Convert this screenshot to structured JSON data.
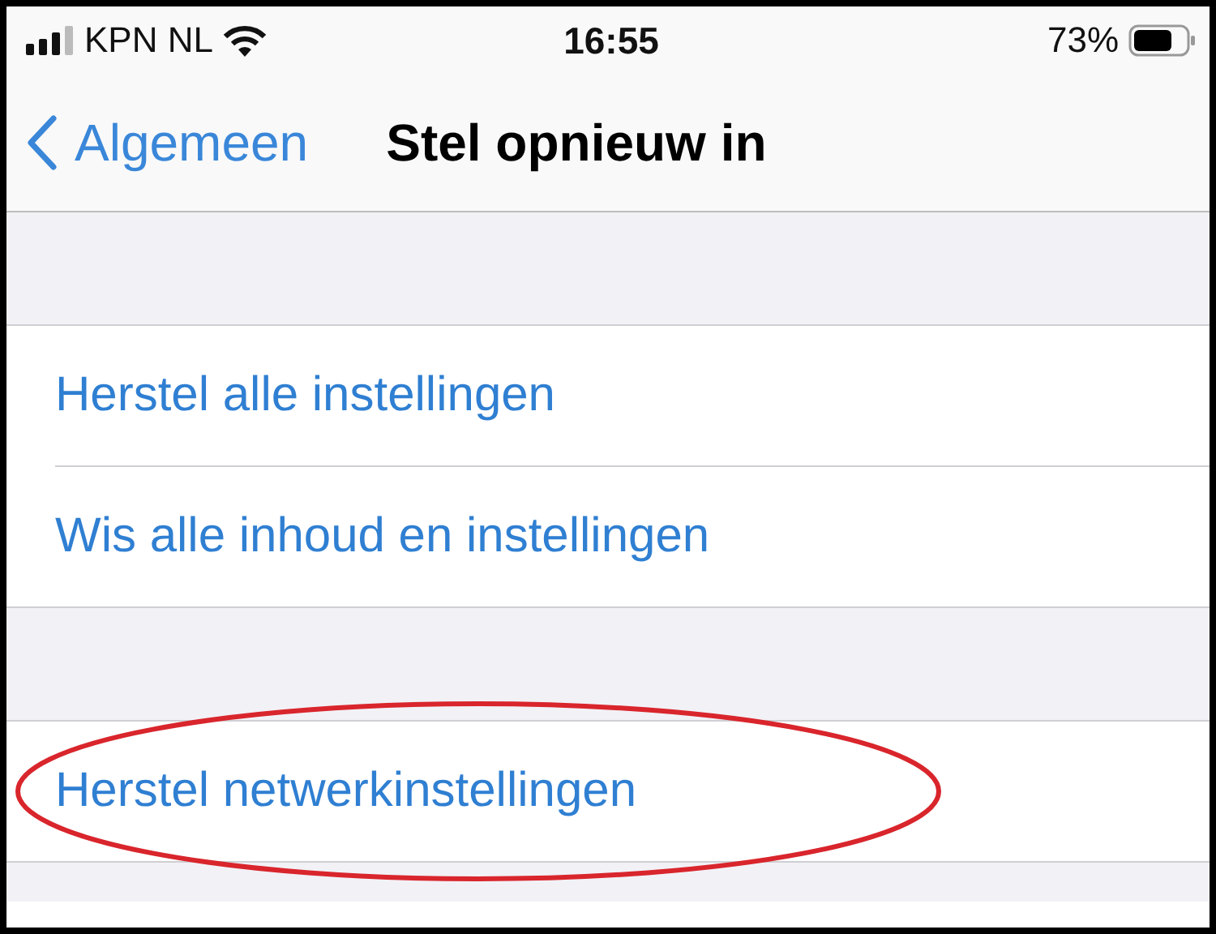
{
  "status_bar": {
    "carrier": "KPN NL",
    "time": "16:55",
    "battery": "73%"
  },
  "nav": {
    "back": "Algemeen",
    "title": "Stel opnieuw in"
  },
  "groups": [
    {
      "items": [
        {
          "label": "Herstel alle instellingen",
          "highlighted": false
        },
        {
          "label": "Wis alle inhoud en instellingen",
          "highlighted": false
        }
      ]
    },
    {
      "items": [
        {
          "label": "Herstel netwerkinstellingen",
          "highlighted": true
        }
      ]
    }
  ]
}
